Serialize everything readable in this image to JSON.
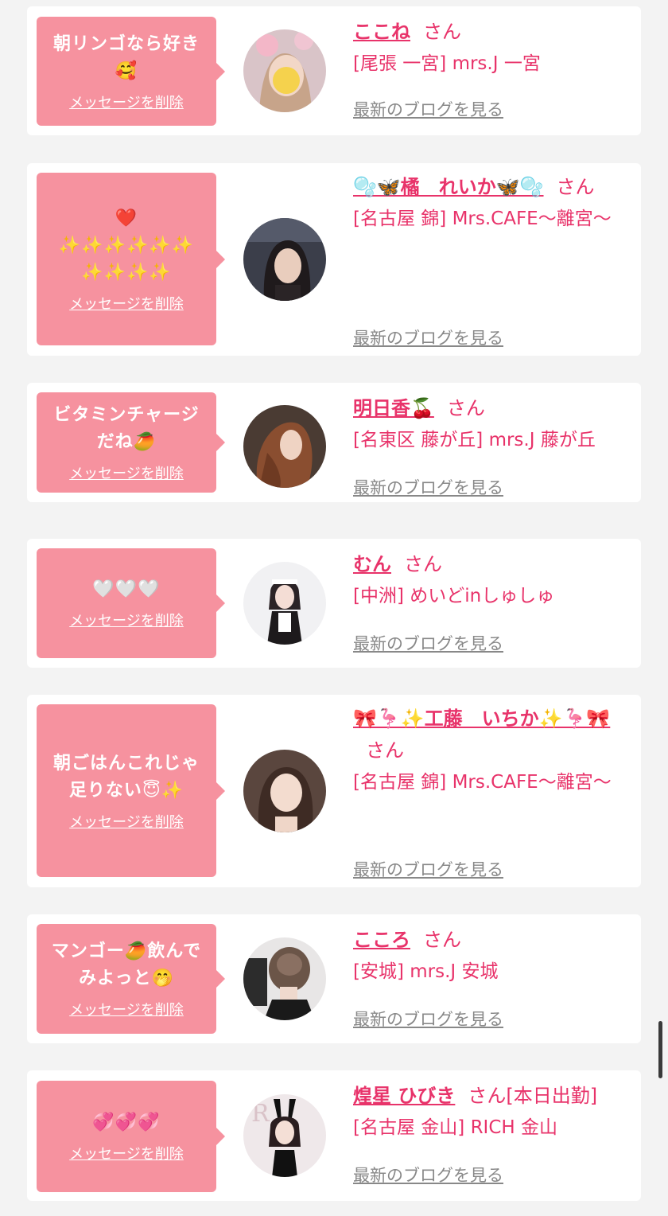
{
  "delete_label": "メッセージを削除",
  "blog_label": "最新のブログを見る",
  "san_label": "さん",
  "colors": {
    "accent": "#e8336a",
    "bubble": "#f6929f",
    "background": "#f3f3f3"
  },
  "items": [
    {
      "message": "朝リンゴなら好き\n🥰",
      "name": "ここね",
      "suffix": "さん",
      "shop": "[尾張 一宮] mrs.J 一宮",
      "avatar_icon": "blurred-woman-photo"
    },
    {
      "message": "❤️\n✨✨✨✨✨✨\n✨✨✨✨",
      "name": "🫧🦋橘　れいか🦋🫧",
      "suffix": "さん",
      "shop": "[名古屋 錦] Mrs.CAFE～離宮～",
      "avatar_icon": "woman-dark-hair-photo"
    },
    {
      "message": "ビタミンチャージ\nだね🥭",
      "name": "明日香🍒",
      "suffix": "さん",
      "shop": "[名東区 藤が丘] mrs.J 藤が丘",
      "avatar_icon": "woman-side-profile-photo"
    },
    {
      "message": "🤍🤍🤍",
      "name": "むん",
      "suffix": "さん",
      "shop": "[中洲] めいどinしゅしゅ",
      "avatar_icon": "maid-costume-photo"
    },
    {
      "message": "朝ごはんこれじゃ\n足りない😇✨",
      "name": "🎀🦩✨工藤　いちか✨🦩🎀",
      "suffix": "さん",
      "shop": "[名古屋 錦] Mrs.CAFE～離宮～",
      "avatar_icon": "woman-portrait-photo"
    },
    {
      "message": "マンゴー🥭飲んで\nみよっと🤭",
      "name": "こころ",
      "suffix": "さん",
      "shop": "[安城] mrs.J 安城",
      "avatar_icon": "hair-back-photo"
    },
    {
      "message": "💞💞💞",
      "name": "煌星 ひびき",
      "suffix": "さん[本日出勤]",
      "shop": "[名古屋 金山] RICH 金山",
      "avatar_icon": "bunny-costume-photo"
    }
  ]
}
